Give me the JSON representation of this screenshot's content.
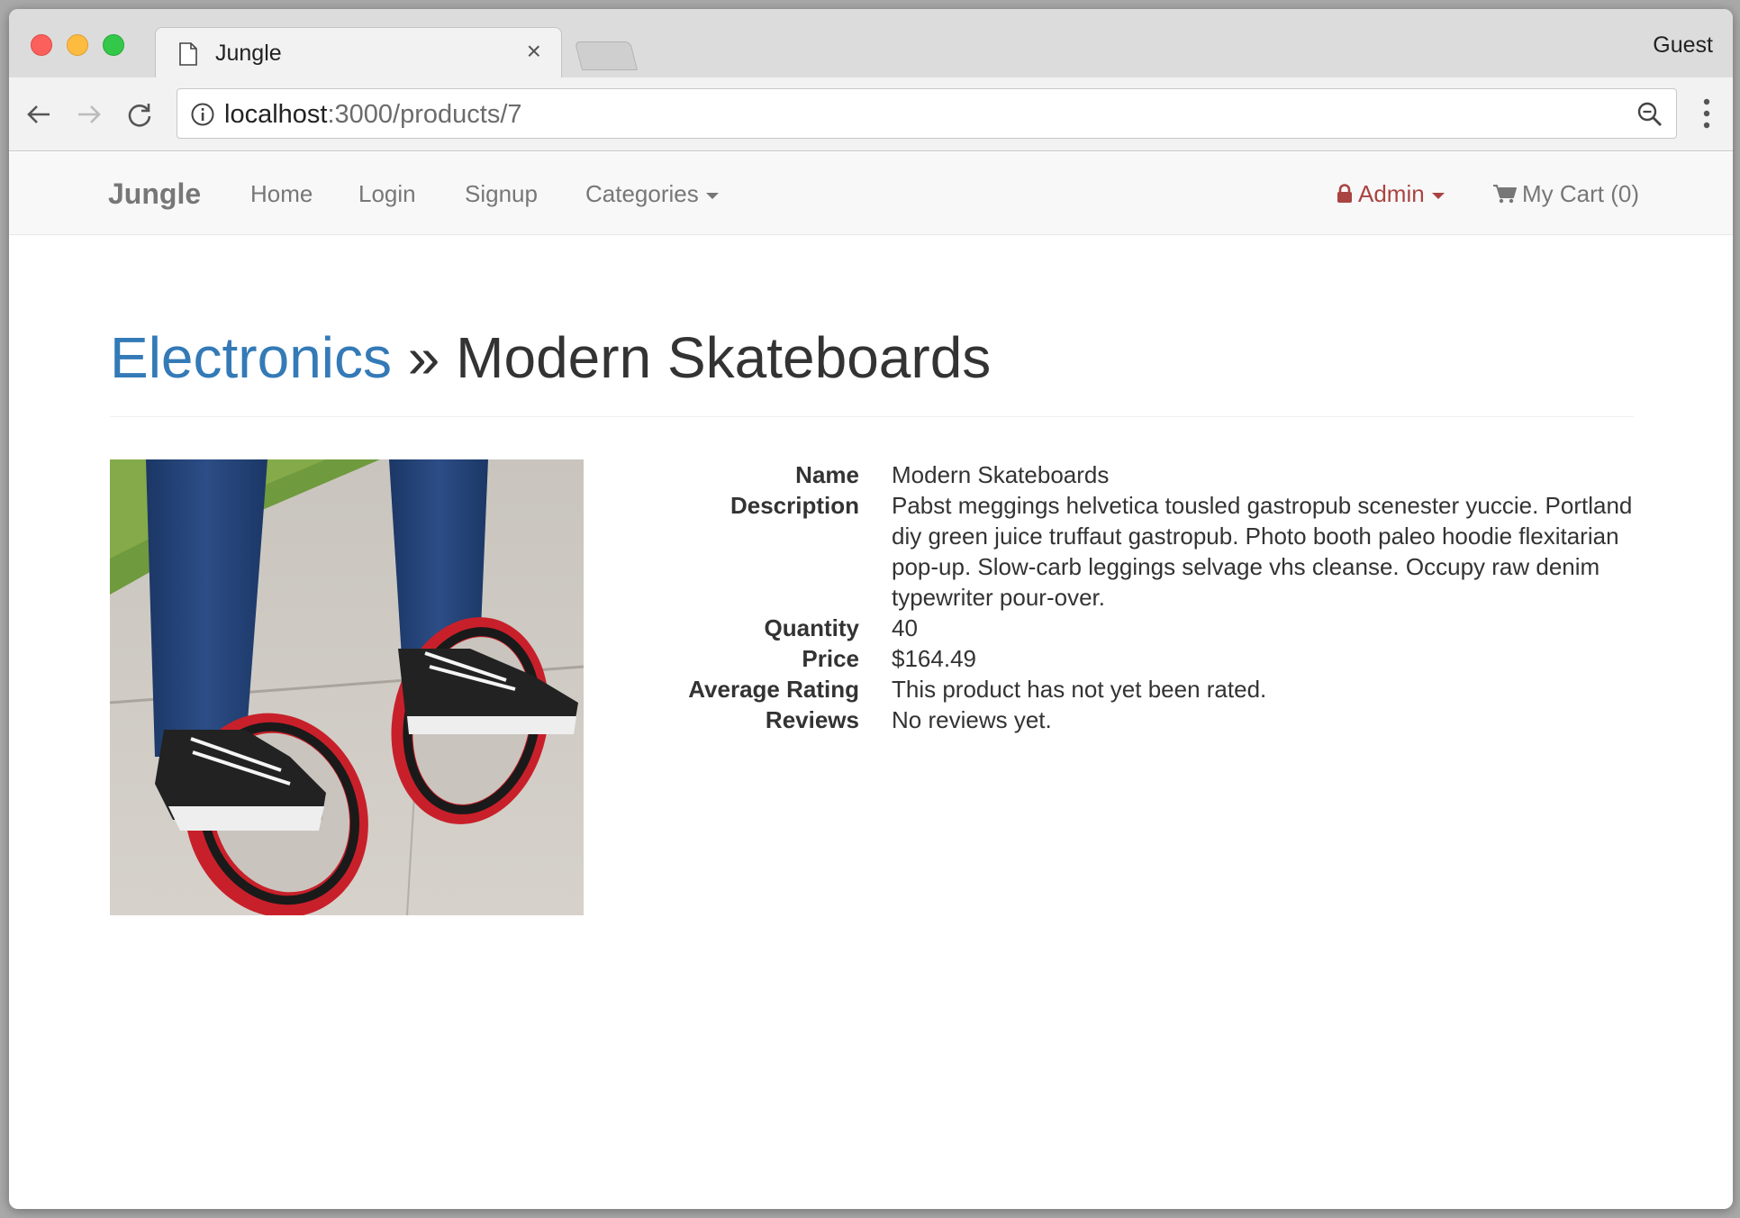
{
  "browser": {
    "tab_title": "Jungle",
    "profile": "Guest",
    "url_host": "localhost",
    "url_path": ":3000/products/7"
  },
  "navbar": {
    "brand": "Jungle",
    "links": [
      "Home",
      "Login",
      "Signup",
      "Categories"
    ],
    "admin": "Admin",
    "cart": "My Cart (0)"
  },
  "product": {
    "category": "Electronics",
    "separator": "»",
    "title": "Modern Skateboards",
    "fields": [
      {
        "label": "Name",
        "value": "Modern Skateboards"
      },
      {
        "label": "Description",
        "value": "Pabst meggings helvetica tousled gastropub scenester yuccie. Portland diy green juice truffaut gastropub. Photo booth paleo hoodie flexitarian pop-up. Slow-carb leggings selvage vhs cleanse. Occupy raw denim typewriter pour-over."
      },
      {
        "label": "Quantity",
        "value": "40"
      },
      {
        "label": "Price",
        "value": "$164.49"
      },
      {
        "label": "Average Rating",
        "value": "This product has not yet been rated."
      },
      {
        "label": "Reviews",
        "value": "No reviews yet."
      }
    ]
  },
  "colors": {
    "link_blue": "#337ab7",
    "admin_red": "#a94442",
    "nav_gray": "#777777"
  }
}
